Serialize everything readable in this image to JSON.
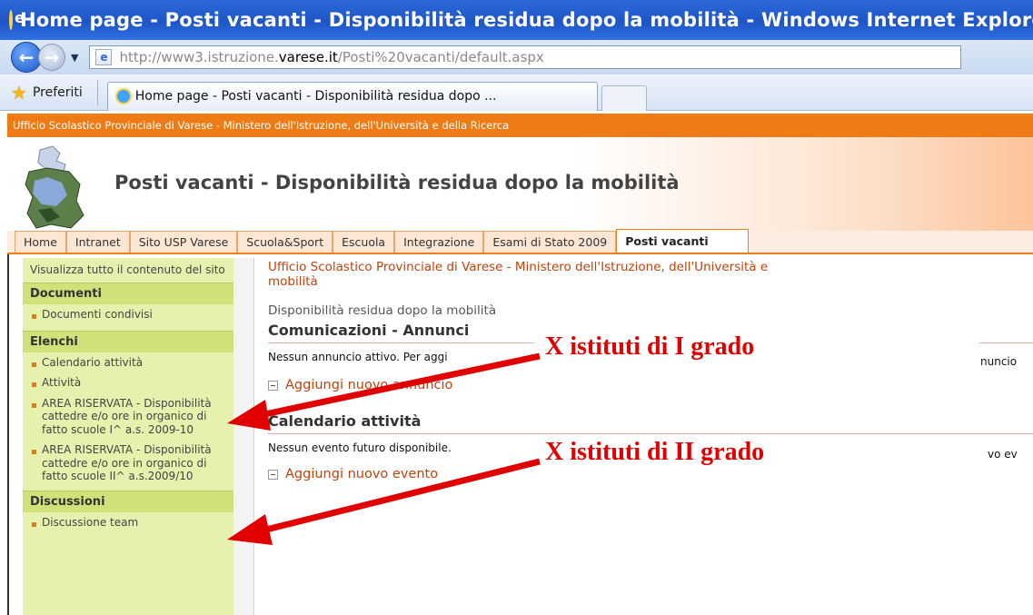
{
  "browser": {
    "window_title": "Home page - Posti vacanti - Disponibilità residua dopo la mobilità - Windows Internet Explorer",
    "url_prefix": "http://www3.istruzione.",
    "url_host": "varese.it",
    "url_path": "/Posti%20vacanti/default.aspx",
    "favorites_label": "Preferiti",
    "tab_title": "Home page - Posti vacanti - Disponibilità residua dopo ..."
  },
  "site": {
    "top_bar": "Ufficio Scolastico Provinciale di Varese - Ministero dell'Istruzione, dell'Università e della Ricerca",
    "title": "Posti vacanti - Disponibilità residua dopo la mobilità",
    "nav_tabs": [
      {
        "label": "Home"
      },
      {
        "label": "Intranet"
      },
      {
        "label": "Sito USP Varese"
      },
      {
        "label": "Scuola&Sport"
      },
      {
        "label": "Escuola"
      },
      {
        "label": "Integrazione"
      },
      {
        "label": "Esami di Stato 2009"
      },
      {
        "label": "Posti vacanti",
        "active": true
      }
    ]
  },
  "sidebar": {
    "view_all": "Visualizza tutto il contenuto del sito",
    "sections": [
      {
        "heading": "Documenti",
        "items": [
          "Documenti condivisi"
        ]
      },
      {
        "heading": "Elenchi",
        "items": [
          "Calendario attività",
          "Attività",
          "AREA RISERVATA - Disponibilità cattedre e/o ore in organico di fatto scuole I^ a.s. 2009-10",
          "AREA RISERVATA - Disponibilità cattedre e/o ore in organico di fatto scuole II^ a.s.2009/10"
        ]
      },
      {
        "heading": "Discussioni",
        "items": [
          "Discussione team"
        ]
      }
    ]
  },
  "content": {
    "breadcrumb_line1": "Ufficio Scolastico Provinciale di Varese - Ministero dell'Istruzione, dell'Università e",
    "breadcrumb_line2": "mobilità",
    "page_subtitle": "Disponibilità residua dopo la mobilità",
    "announcements": {
      "title": "Comunicazioni - Annunci",
      "message": "Nessun annuncio attivo. Per aggi",
      "message_tail": "nuncio",
      "add_link": "Aggiungi nuovo annuncio"
    },
    "calendar": {
      "title": "Calendario attività",
      "message": "Nessun evento futuro disponibile.",
      "message_tail": "vo ev",
      "add_link": "Aggiungi nuovo evento"
    }
  },
  "annotations": {
    "first": "X istituti di I grado",
    "second": "X istituti di II grado",
    "color": "#e00000"
  }
}
